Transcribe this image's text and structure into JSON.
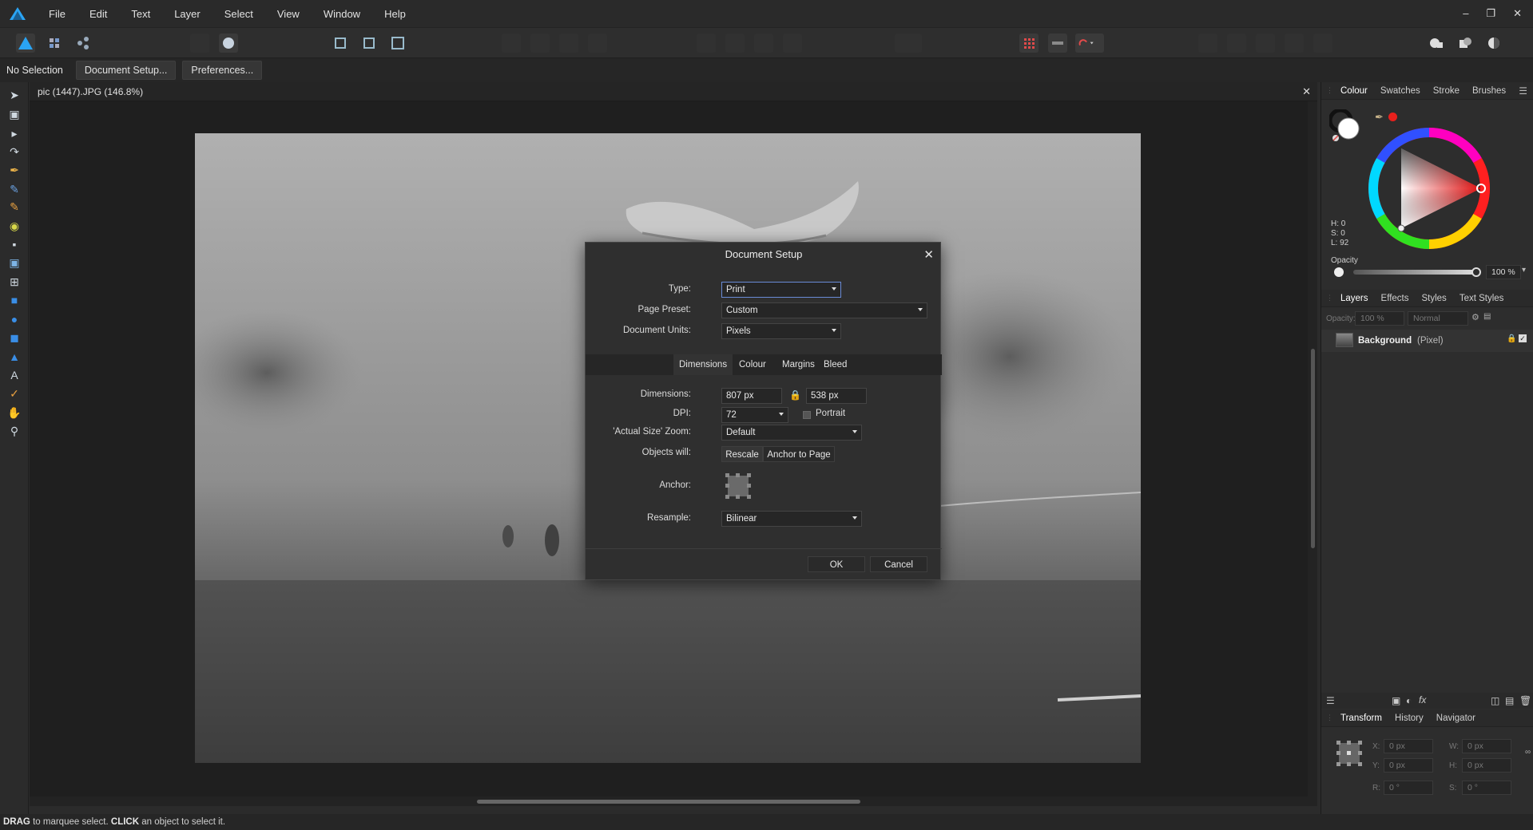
{
  "menubar": {
    "items": [
      "File",
      "Edit",
      "Text",
      "Layer",
      "Select",
      "View",
      "Window",
      "Help"
    ]
  },
  "contextbar": {
    "selection_status": "No Selection",
    "document_setup_button": "Document Setup...",
    "preferences_button": "Preferences..."
  },
  "document": {
    "tab_title": "pic (1447).JPG (146.8%)"
  },
  "right_panel": {
    "colour_tabs": [
      "Colour",
      "Swatches",
      "Stroke",
      "Brushes"
    ],
    "hsl": {
      "h": "H: 0",
      "s": "S: 0",
      "l": "L: 92"
    },
    "opacity_label": "Opacity",
    "opacity_value": "100 %",
    "layer_tabs": [
      "Layers",
      "Effects",
      "Styles",
      "Text Styles"
    ],
    "layers_opacity_label": "Opacity:",
    "layers_opacity_value": "100 %",
    "blend_mode": "Normal",
    "layer_name": "Background",
    "layer_type": "(Pixel)",
    "transform_tabs": [
      "Transform",
      "History",
      "Navigator"
    ],
    "transform": {
      "x_label": "X:",
      "x_value": "0 px",
      "y_label": "Y:",
      "y_value": "0 px",
      "w_label": "W:",
      "w_value": "0 px",
      "h_label": "H:",
      "h_value": "0 px",
      "r_label": "R:",
      "r_value": "0 °",
      "s_label": "S:",
      "s_value": "0 °"
    }
  },
  "dialog": {
    "title": "Document Setup",
    "type_label": "Type:",
    "type_value": "Print",
    "page_preset_label": "Page Preset:",
    "page_preset_value": "Custom",
    "document_units_label": "Document Units:",
    "document_units_value": "Pixels",
    "tabs": [
      "Dimensions",
      "Colour",
      "Margins",
      "Bleed"
    ],
    "dimensions_label": "Dimensions:",
    "width_value": "807 px",
    "height_value": "538 px",
    "dpi_label": "DPI:",
    "dpi_value": "72",
    "portrait_label": "Portrait",
    "actual_size_zoom_label": "'Actual Size' Zoom:",
    "actual_size_zoom_value": "Default",
    "objects_will_label": "Objects will:",
    "rescale_button": "Rescale",
    "anchor_to_page_button": "Anchor to Page",
    "anchor_label": "Anchor:",
    "resample_label": "Resample:",
    "resample_value": "Bilinear",
    "ok_button": "OK",
    "cancel_button": "Cancel"
  },
  "statusbar": {
    "drag_word": "DRAG",
    "drag_text": "to marquee select.",
    "click_word": "CLICK",
    "click_text": "an object to select it."
  },
  "colors": {
    "accent": "#6a8bd6",
    "app_logo": "#2aa4f4",
    "foreground_swatch": "#ffffff",
    "background_swatch": "#1a1a1a",
    "picker_red": "#e8201c"
  }
}
